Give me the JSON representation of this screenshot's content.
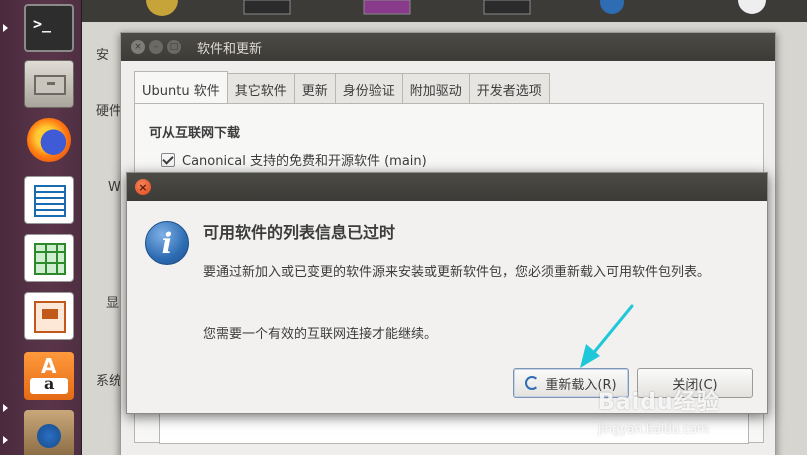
{
  "launcher": {
    "items": [
      "terminal",
      "files",
      "firefox",
      "libreoffice-writer",
      "libreoffice-calc",
      "libreoffice-impress",
      "amazon",
      "software-updater"
    ],
    "terminal_glyph": ">_",
    "amazon_glyph": "A",
    "amazon_sub": "a"
  },
  "background": {
    "side_labels": [
      "安",
      "硬件",
      "W",
      "显",
      "系统"
    ]
  },
  "window": {
    "title": "软件和更新",
    "tabs": [
      {
        "label": "Ubuntu 软件",
        "active": true
      },
      {
        "label": "其它软件",
        "active": false
      },
      {
        "label": "更新",
        "active": false
      },
      {
        "label": "身份验证",
        "active": false
      },
      {
        "label": "附加驱动",
        "active": false
      },
      {
        "label": "开发者选项",
        "active": false
      }
    ],
    "section_heading": "可从互联网下载",
    "checkbox_label": "Canonical 支持的免费和开源软件 (main)"
  },
  "dialog": {
    "heading": "可用软件的列表信息已过时",
    "body": "要通过新加入或已变更的软件源来安装或更新软件包，您必须重新载入可用软件包列表。",
    "note": "您需要一个有效的互联网连接才能继续。",
    "reload_label": "重新载入(R)",
    "close_label": "关闭(C)",
    "info_glyph": "i",
    "close_glyph": "×"
  },
  "watermark": {
    "logo": "Baidu经验",
    "url": "jingyan.baidu.com"
  },
  "colors": {
    "launcher": "#5a3549",
    "titlebar": "#3c3b37",
    "accent": "#2e6db3",
    "arrow": "#1ec8d8",
    "close_button": "#df4a1a"
  }
}
